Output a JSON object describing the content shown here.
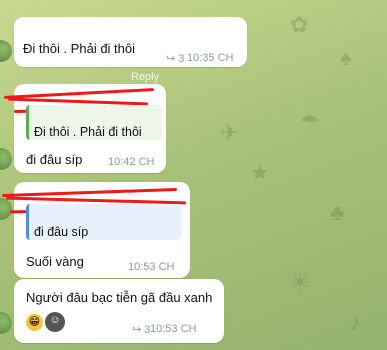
{
  "messages": [
    {
      "text": "Đi thôi . Phải đi thôi",
      "replies": "3",
      "time": "10:35 CH"
    },
    {
      "reply_quote": "Đi thôi . Phải đi thôi",
      "text": "đi đâu síp",
      "time": "10:42 CH"
    },
    {
      "reply_quote": "đi đâu síp",
      "text": "Suối vàng",
      "time": "10:53 CH"
    },
    {
      "text": "Người đâu bạc tiễn gã đầu xanh",
      "replies": "3",
      "time": "10:53 CH",
      "reactions": [
        "grinning-emoji",
        "sticker-reaction"
      ]
    }
  ],
  "ghost_reply_label": "Reply",
  "colors": {
    "background": "#a9c27a",
    "bubble": "#ffffff",
    "time": "#8c9aa3",
    "redaction": "#ee1a1a",
    "reply_green": "#5eab5a",
    "reply_blue": "#4a90d9"
  }
}
